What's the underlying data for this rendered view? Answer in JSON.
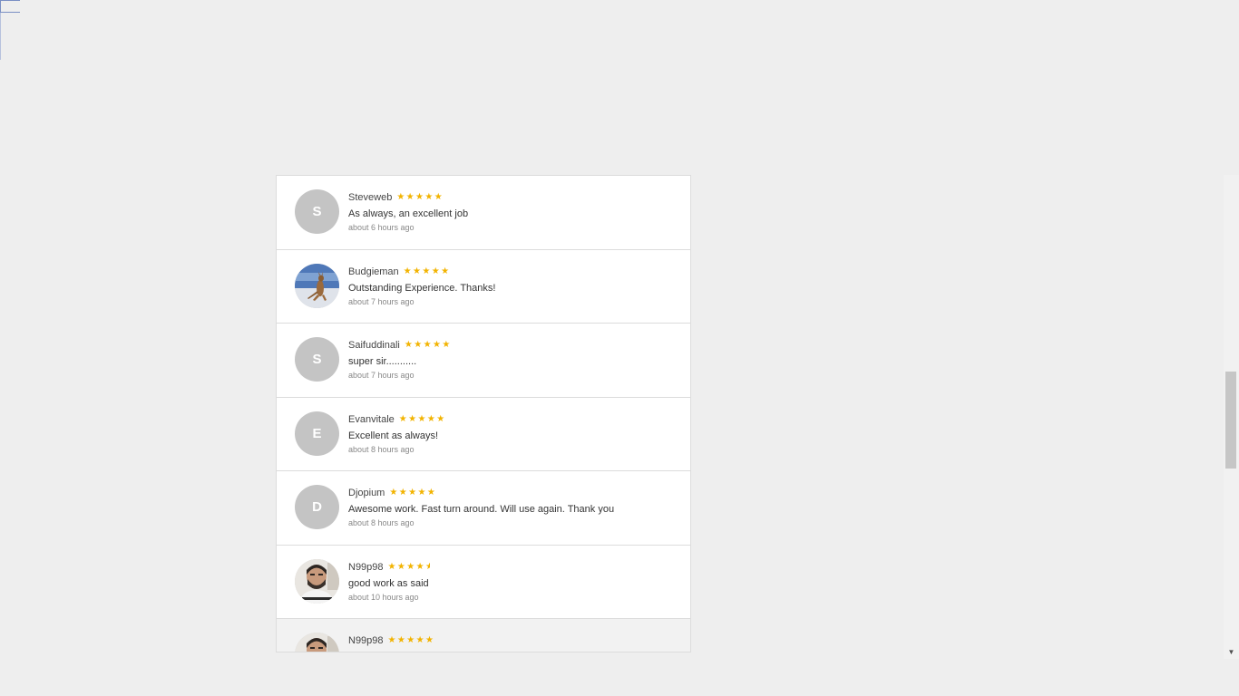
{
  "reviews": [
    {
      "name": "Steveweb",
      "initial": "S",
      "avatar": "initial",
      "rating": 5,
      "stars": "★★★★★",
      "text": "As always, an excellent job",
      "time": "about 6 hours ago"
    },
    {
      "name": "Budgieman",
      "initial": "",
      "avatar": "kangaroo-photo",
      "rating": 5,
      "stars": "★★★★★",
      "text": "Outstanding Experience. Thanks!",
      "time": "about 7 hours ago"
    },
    {
      "name": "Saifuddinali",
      "initial": "S",
      "avatar": "initial",
      "rating": 5,
      "stars": "★★★★★",
      "text": "super sir...........",
      "time": "about 7 hours ago"
    },
    {
      "name": "Evanvitale",
      "initial": "E",
      "avatar": "initial",
      "rating": 5,
      "stars": "★★★★★",
      "text": "Excellent as always!",
      "time": "about 8 hours ago"
    },
    {
      "name": "Djopium",
      "initial": "D",
      "avatar": "initial",
      "rating": 5,
      "stars": "★★★★★",
      "text": "Awesome work. Fast turn around. Will use again. Thank you",
      "time": "about 8 hours ago"
    },
    {
      "name": "N99p98",
      "initial": "",
      "avatar": "man-photo",
      "rating": 4.5,
      "stars": "★★★★",
      "half_star": "★",
      "text": "good work as said",
      "time": "about 10 hours ago"
    },
    {
      "name": "N99p98",
      "initial": "",
      "avatar": "man-photo",
      "rating": 5,
      "stars": "★★★★★",
      "text": "",
      "time": ""
    }
  ],
  "colors": {
    "star": "#f2b300",
    "avatar_bg": "#c4c4c4",
    "page_bg": "#eeeeee"
  },
  "icons": {
    "scroll_down": "▼"
  },
  "scroll": {
    "position_fraction": 0.41
  }
}
